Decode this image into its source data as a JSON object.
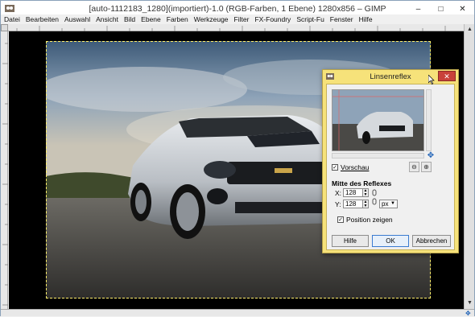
{
  "window": {
    "title": "[auto-1112183_1280](importiert)-1.0 (RGB-Farben, 1 Ebene) 1280x856 – GIMP",
    "minimize": "–",
    "maximize": "□",
    "close": "✕"
  },
  "menu": [
    "Datei",
    "Bearbeiten",
    "Auswahl",
    "Ansicht",
    "Bild",
    "Ebene",
    "Farben",
    "Werkzeuge",
    "Filter",
    "FX-Foundry",
    "Script-Fu",
    "Fenster",
    "Hilfe"
  ],
  "dialog": {
    "title": "Linsenreflex",
    "close": "✕",
    "preview_label": "Vorschau",
    "preview_checked": true,
    "section_title": "Mitte des Reflexes",
    "x_label": "X:",
    "x_value": "128",
    "y_label": "Y:",
    "y_value": "128",
    "unit": "px",
    "show_position_label": "Position zeigen",
    "show_position_checked": true,
    "buttons": {
      "help": "Hilfe",
      "ok": "OK",
      "cancel": "Abbrechen"
    }
  },
  "colors": {
    "canvas_bg": "#000000",
    "selection": "#ffef6a",
    "dialog_frame": "#f6e27a",
    "close_red": "#c9413a"
  }
}
